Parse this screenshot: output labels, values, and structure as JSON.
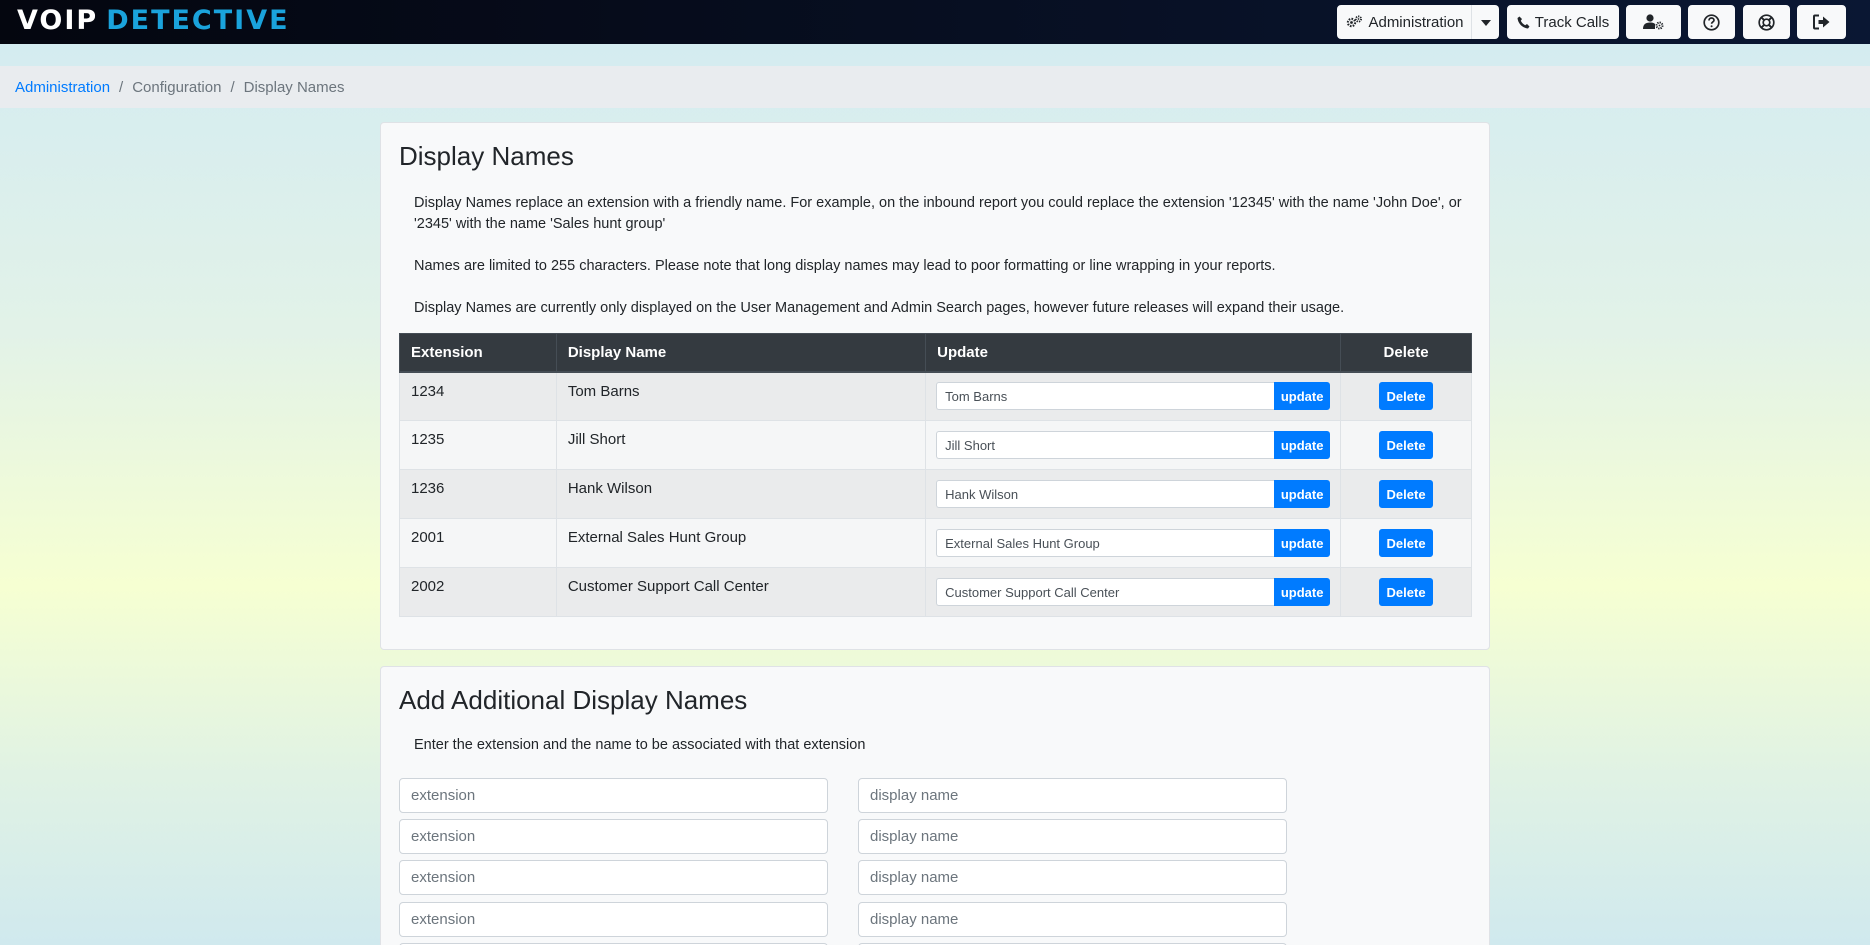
{
  "header": {
    "logo_left": "VOIP",
    "logo_right": "DETECTIVE",
    "admin_label": "Administration",
    "track_label": "Track Calls"
  },
  "breadcrumb": {
    "items": [
      "Administration",
      "Configuration",
      "Display Names"
    ],
    "separator": "/"
  },
  "display_names": {
    "title": "Display Names",
    "paragraphs": [
      "Display Names replace an extension with a friendly name. For example, on the inbound report you could replace the extension '12345' with the name 'John Doe', or '2345' with the name 'Sales hunt group'",
      "Names are limited to 255 characters. Please note that long display names may lead to poor formatting or line wrapping in your reports.",
      "Display Names are currently only displayed on the User Management and Admin Search pages, however future releases will expand their usage."
    ],
    "table": {
      "headers": [
        "Extension",
        "Display Name",
        "Update",
        "Delete"
      ],
      "update_label": "update",
      "delete_label": "Delete",
      "rows": [
        {
          "extension": "1234",
          "name": "Tom Barns",
          "value": "Tom Barns"
        },
        {
          "extension": "1235",
          "name": "Jill Short",
          "value": "Jill Short"
        },
        {
          "extension": "1236",
          "name": "Hank Wilson",
          "value": "Hank Wilson"
        },
        {
          "extension": "2001",
          "name": "External Sales Hunt Group",
          "value": "External Sales Hunt Group"
        },
        {
          "extension": "2002",
          "name": "Customer Support Call Center",
          "value": "Customer Support Call Center"
        }
      ]
    }
  },
  "add_section": {
    "title": "Add Additional Display Names",
    "description": "Enter the extension and the name to be associated with that extension",
    "extension_placeholder": "extension",
    "name_placeholder": "display name"
  },
  "colors": {
    "primary": "#007bff",
    "navbar": "#0a1733",
    "logo_accent": "#1aa3dc",
    "table_header": "#343a40"
  }
}
